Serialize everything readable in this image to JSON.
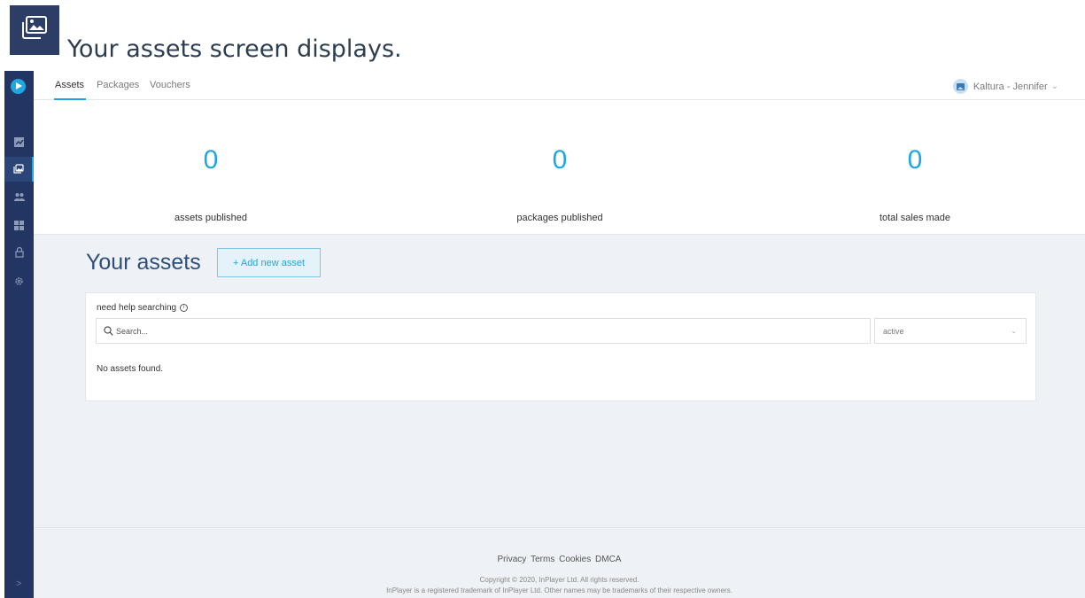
{
  "caption": {
    "text": "Your assets screen displays."
  },
  "topbar": {
    "tabs": [
      {
        "label": "Assets",
        "active": true
      },
      {
        "label": "Packages",
        "active": false
      },
      {
        "label": "Vouchers",
        "active": false
      }
    ],
    "account_name": "Kaltura - Jennifer"
  },
  "sidebar": {
    "items": [
      {
        "icon": "analytics-icon",
        "active": false
      },
      {
        "icon": "assets-icon",
        "active": true
      },
      {
        "icon": "audience-icon",
        "active": false
      },
      {
        "icon": "grid-icon",
        "active": false
      },
      {
        "icon": "lock-icon",
        "active": false
      },
      {
        "icon": "gear-icon",
        "active": false
      }
    ],
    "expand_glyph": ">"
  },
  "stats": [
    {
      "value": "0",
      "label": "assets published"
    },
    {
      "value": "0",
      "label": "packages published"
    },
    {
      "value": "0",
      "label": "total sales made"
    }
  ],
  "content": {
    "title": "Your assets",
    "add_button": "+ Add new asset",
    "help_text": "need help searching",
    "search_placeholder": "Search...",
    "status_selected": "active",
    "empty_message": "No assets found."
  },
  "footer": {
    "links": [
      "Privacy",
      "Terms",
      "Cookies",
      "DMCA"
    ],
    "copyright": "Copyright © 2020, InPlayer Ltd. All rights reserved.",
    "trademark": "InPlayer is a registered trademark of InPlayer Ltd. Other names may be trademarks of their respective owners."
  },
  "colors": {
    "sidebar": "#233563",
    "accent": "#1ea7e1",
    "content_bg": "#eef1f5",
    "title": "#2d4f7c"
  }
}
